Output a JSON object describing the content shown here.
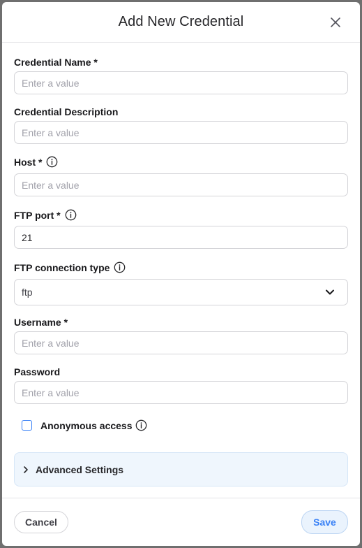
{
  "dialog": {
    "title": "Add New Credential",
    "close_icon": "close-icon"
  },
  "fields": {
    "credential_name": {
      "label": "Credential Name *",
      "placeholder": "Enter a value",
      "value": ""
    },
    "credential_description": {
      "label": "Credential Description",
      "placeholder": "Enter a value",
      "value": ""
    },
    "host": {
      "label": "Host *",
      "placeholder": "Enter a value",
      "value": "",
      "icon": "info-icon"
    },
    "ftp_port": {
      "label": "FTP port *",
      "placeholder": "",
      "value": "21",
      "icon": "info-icon"
    },
    "ftp_connection_type": {
      "label": "FTP connection type",
      "selected": "ftp",
      "icon": "info-icon",
      "dropdown_icon": "chevron-down-icon"
    },
    "username": {
      "label": "Username *",
      "placeholder": "Enter a value",
      "value": ""
    },
    "password": {
      "label": "Password",
      "placeholder": "Enter a value",
      "value": ""
    }
  },
  "anonymous_access": {
    "label": "Anonymous access",
    "checked": false,
    "icon": "info-icon"
  },
  "advanced_settings": {
    "label": "Advanced Settings",
    "expanded": false,
    "icon": "chevron-right-icon"
  },
  "footer": {
    "cancel_label": "Cancel",
    "save_label": "Save"
  },
  "colors": {
    "accent": "#3b82f6",
    "advanced_bg": "#eff6fd",
    "border": "#d4d4d8",
    "backdrop": "#6f6f6f"
  }
}
